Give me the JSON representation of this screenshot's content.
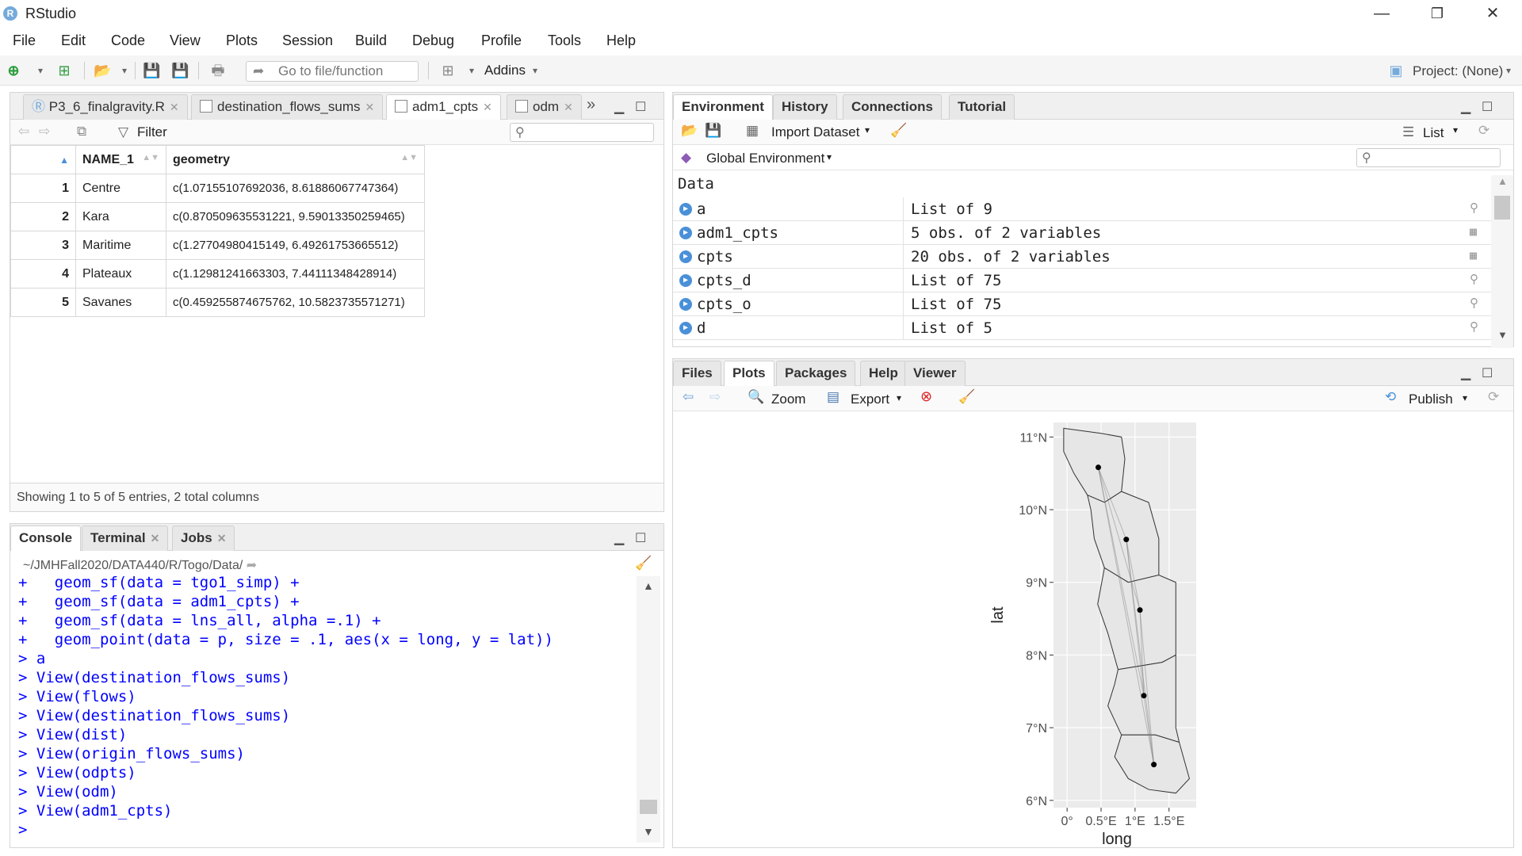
{
  "window": {
    "title": "RStudio",
    "minimize": "—",
    "restore": "❐",
    "close": "✕"
  },
  "menu": [
    "File",
    "Edit",
    "Code",
    "View",
    "Plots",
    "Session",
    "Build",
    "Debug",
    "Profile",
    "Tools",
    "Help"
  ],
  "toolbar": {
    "goto_placeholder": "Go to file/function",
    "addins": "Addins",
    "project": "Project: (None)"
  },
  "source": {
    "tabs": [
      {
        "label": "P3_6_finalgravity.R"
      },
      {
        "label": "destination_flows_sums"
      },
      {
        "label": "adm1_cpts"
      },
      {
        "label": "odm"
      }
    ],
    "filter_label": "Filter",
    "columns": [
      "",
      "NAME_1",
      "geometry"
    ],
    "rows": [
      {
        "n": "1",
        "name": "Centre",
        "geometry": "c(1.07155107692036, 8.61886067747364)"
      },
      {
        "n": "2",
        "name": "Kara",
        "geometry": "c(0.870509635531221, 9.59013350259465)"
      },
      {
        "n": "3",
        "name": "Maritime",
        "geometry": "c(1.27704980415149, 6.49261753665512)"
      },
      {
        "n": "4",
        "name": "Plateaux",
        "geometry": "c(1.12981241663303, 7.44111348428914)"
      },
      {
        "n": "5",
        "name": "Savanes",
        "geometry": "c(0.459255874675762, 10.5823735571271)"
      }
    ],
    "status": "Showing 1 to 5 of 5 entries, 2 total columns"
  },
  "console": {
    "tabs": [
      "Console",
      "Terminal",
      "Jobs"
    ],
    "path": "~/JMHFall2020/DATA440/R/Togo/Data/",
    "lines": [
      "+   geom_sf(data = tgo1_simp) +",
      "+   geom_sf(data = adm1_cpts) +",
      "+   geom_sf(data = lns_all, alpha =.1) +",
      "+   geom_point(data = p, size = .1, aes(x = long, y = lat))",
      "> a",
      "> View(destination_flows_sums)",
      "> View(flows)",
      "> View(destination_flows_sums)",
      "> View(dist)",
      "> View(origin_flows_sums)",
      "> View(odpts)",
      "> View(odm)",
      "> View(adm1_cpts)",
      "> "
    ]
  },
  "environment": {
    "tabs": [
      "Environment",
      "History",
      "Connections",
      "Tutorial"
    ],
    "import_label": "Import Dataset",
    "list_label": "List",
    "scope": "Global Environment",
    "section": "Data",
    "rows": [
      {
        "name": "a",
        "value": "List of 9",
        "icon": "search-icon"
      },
      {
        "name": "adm1_cpts",
        "value": "5 obs. of 2 variables",
        "icon": "table-icon"
      },
      {
        "name": "cpts",
        "value": "20 obs. of 2 variables",
        "icon": "table-icon"
      },
      {
        "name": "cpts_d",
        "value": "List of 75",
        "icon": "search-icon"
      },
      {
        "name": "cpts_o",
        "value": "List of 75",
        "icon": "search-icon"
      },
      {
        "name": "d",
        "value": "List of 5",
        "icon": "search-icon"
      }
    ]
  },
  "files": {
    "tabs": [
      "Files",
      "Plots",
      "Packages",
      "Help",
      "Viewer"
    ],
    "zoom_label": "Zoom",
    "export_label": "Export",
    "publish_label": "Publish"
  },
  "chart_data": {
    "type": "scatter",
    "xlabel": "long",
    "ylabel": "lat",
    "x_ticks": [
      "0°",
      "0.5°E",
      "1°E",
      "1.5°E"
    ],
    "y_ticks": [
      "6°N",
      "7°N",
      "8°N",
      "9°N",
      "10°N",
      "11°N"
    ],
    "xlim": [
      -0.2,
      1.9
    ],
    "ylim": [
      5.9,
      11.2
    ],
    "points": [
      {
        "x": 0.459,
        "y": 10.582
      },
      {
        "x": 0.871,
        "y": 9.59
      },
      {
        "x": 1.072,
        "y": 8.619
      },
      {
        "x": 1.13,
        "y": 7.441
      },
      {
        "x": 1.277,
        "y": 6.493
      }
    ],
    "colors": {
      "panel": "#ebebeb",
      "grid": "#ffffff",
      "region": "#e6e6e6",
      "point": "#000000"
    }
  }
}
